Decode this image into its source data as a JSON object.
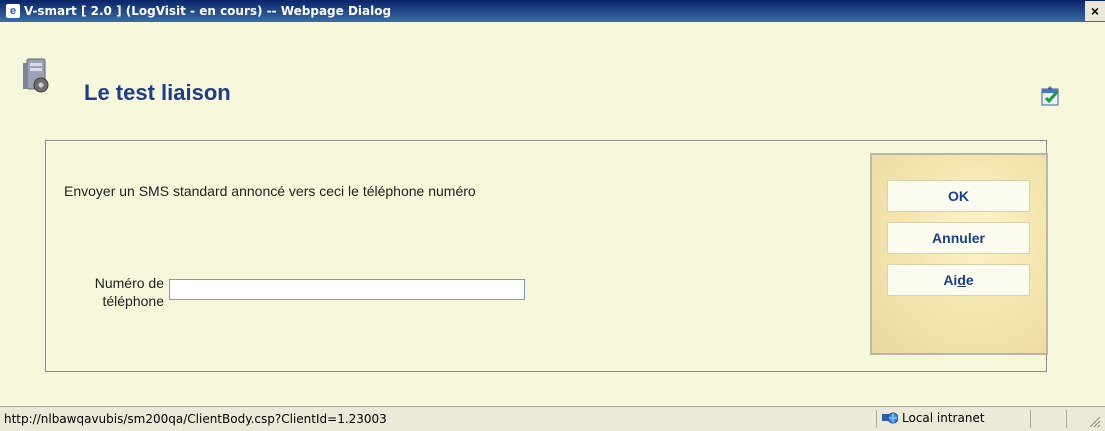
{
  "window": {
    "title": "V-smart [ 2.0 ] (LogVisit - en cours) -- Webpage Dialog",
    "close_glyph": "×",
    "app_icon": "ie-page-icon"
  },
  "page": {
    "title": "Le test liaison",
    "title_color": "#1c3d8c",
    "header_icon": "server-gear-icon",
    "corner_icon": "window-check-icon"
  },
  "form": {
    "description": "Envoyer un SMS standard annoncé vers ceci le téléphone numéro",
    "phone_label_line1": "Numéro de",
    "phone_label_line2": "téléphone",
    "phone_value": ""
  },
  "buttons": {
    "ok": "OK",
    "cancel": "Annuler",
    "help_prefix": "Ai",
    "help_accel": "d",
    "help_suffix": "e"
  },
  "statusbar": {
    "url": "http://nlbawqavubis/sm200qa/ClientBody.csp?ClientId=1.23003",
    "zone": "Local intranet"
  }
}
